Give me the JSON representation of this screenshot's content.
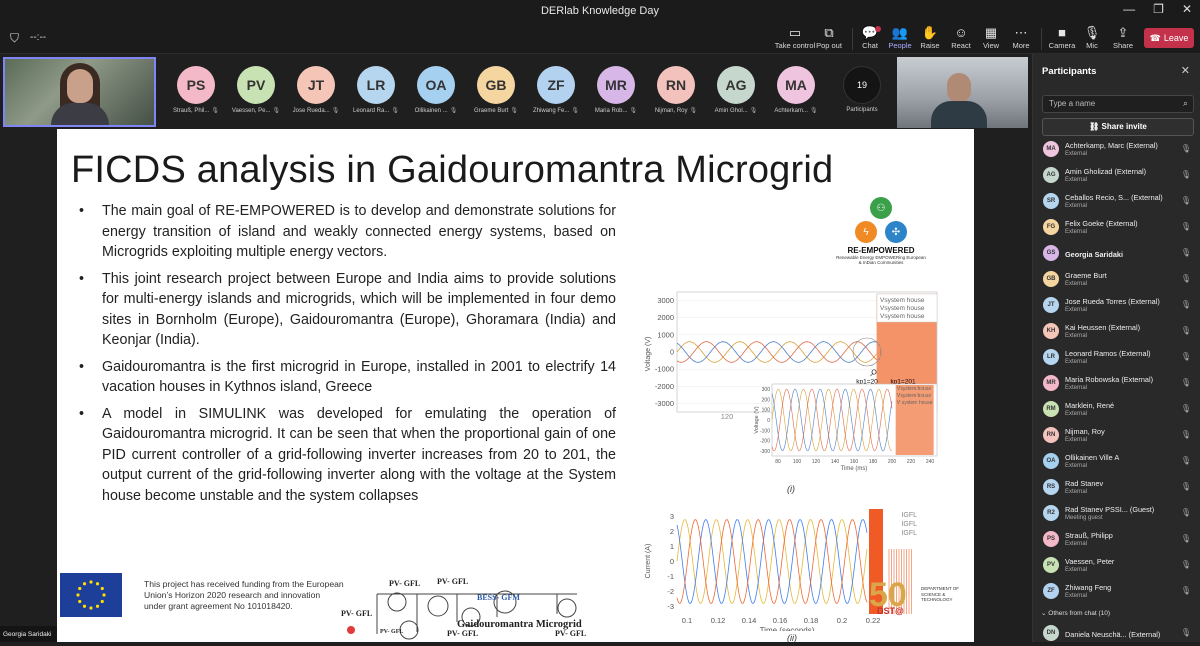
{
  "window": {
    "title": "DERlab Knowledge Day",
    "controls": [
      "—",
      "❐",
      "✕"
    ]
  },
  "meeting": {
    "timer": "--:--"
  },
  "toolbar": {
    "items": [
      {
        "label": "Take control",
        "icon": "▭"
      },
      {
        "label": "Pop out",
        "icon": "⧉"
      },
      {
        "label": "Chat",
        "icon": "💬"
      },
      {
        "label": "People",
        "icon": "👥"
      },
      {
        "label": "Raise",
        "icon": "✋"
      },
      {
        "label": "React",
        "icon": "☺"
      },
      {
        "label": "View",
        "icon": "▦"
      },
      {
        "label": "More",
        "icon": "⋯"
      },
      {
        "label": "Camera",
        "icon": "■"
      },
      {
        "label": "Mic",
        "icon": "🎙"
      },
      {
        "label": "Share",
        "icon": "⇪"
      }
    ],
    "leave_label": "Leave",
    "leave_color": "#c4314b",
    "accent": "#a9acff"
  },
  "strip": {
    "tiles": [
      {
        "initials": "PS",
        "name": "Strauß, Phil...",
        "color": "#f4b9c8"
      },
      {
        "initials": "PV",
        "name": "Vaessen, Pe...",
        "color": "#c9e2b3"
      },
      {
        "initials": "JT",
        "name": "Jose Rueda...",
        "color": "#f5c6b7"
      },
      {
        "initials": "LR",
        "name": "Leonard Ra...",
        "color": "#b6d5ef"
      },
      {
        "initials": "OA",
        "name": "Ollikainen ...",
        "color": "#a6d0ef"
      },
      {
        "initials": "GB",
        "name": "Graeme Burt",
        "color": "#f6d6a0"
      },
      {
        "initials": "ZF",
        "name": "Zhiwang Fe...",
        "color": "#b2d2f0"
      },
      {
        "initials": "MR",
        "name": "Maria Rob...",
        "color": "#d7b7e8"
      },
      {
        "initials": "RN",
        "name": "Nijman, Roy",
        "color": "#f4c2bd"
      },
      {
        "initials": "AG",
        "name": "Amin Ghol...",
        "color": "#c6d8ce"
      },
      {
        "initials": "MA",
        "name": "Achterkam...",
        "color": "#efc4de"
      }
    ],
    "participants_count": "19",
    "participants_label": "Participants"
  },
  "slide": {
    "title": "FICDS analysis in Gaidouromantra Microgrid",
    "bullets": [
      "The main goal of RE-EMPOWERED is to develop and demonstrate solutions for energy transition of island and weakly connected energy systems, based on Microgrids exploiting multiple energy vectors.",
      "This joint research project between Europe and India aims to provide solutions for multi-energy islands and microgrids, which will be implemented in four demo sites in Bornholm (Europe), Gaidouromantra (Europe), Ghoramara (India) and Keonjar (India).",
      "Gaidouromantra is the first microgrid in Europe, installed in 2001 to electrify 14 vacation houses in Kythnos island, Greece",
      "A model in SIMULINK was developed for emulating the operation of Gaidouromantra microgrid. It can be seen that when the proportional gain of one PID current controller of a grid-following inverter increases from 20 to 201, the output current of the grid-following inverter along with the voltage at the System house become unstable and the system collapses"
    ],
    "logo": {
      "name": "RE-EMPOWERED",
      "tagline": "Renewable Energy EMPOWERing European & InDian Communities"
    },
    "funding_text": "This project has received funding from the European Union’s Horizon 2020 research and innovation under grant agreement No 101018420.",
    "diagram": {
      "title": "Gaidouromantra Microgrid",
      "labels": [
        "PV- GFL",
        "PV- GFL",
        "PV- GFL",
        "PV- GFL",
        "PV- GFL",
        "PV- GFL",
        "BESS- GFM"
      ]
    },
    "dst": {
      "fifty": "50",
      "label": "DST@",
      "dept": "DEPARTMENT OF SCIENCE & TECHNOLOGY"
    },
    "figure_labels": {
      "top": "(i)",
      "bottom": "(ii)"
    }
  },
  "chart_data": [
    {
      "type": "line",
      "title": "",
      "ylabel": "Voltage (V)",
      "xlabel": "",
      "ylim": [
        -3500,
        3500
      ],
      "yticks": [
        3000,
        2000,
        1000,
        0,
        -1000,
        -2000,
        -3000
      ],
      "legend": [
        "Vsystem house",
        "Vsystem house",
        "Vsystem house"
      ],
      "annotations": [
        "kp1=20",
        "kp1=201"
      ],
      "series": [
        {
          "color": "#d9a33a"
        },
        {
          "color": "#4f7fc9"
        },
        {
          "color": "#e06a4a"
        }
      ]
    },
    {
      "type": "line",
      "ylabel": "Voltage (V)",
      "xlabel": "Time (ms)",
      "xticks": [
        80,
        100,
        120,
        140,
        160,
        180,
        200,
        220,
        240
      ],
      "yticks": [
        300,
        200,
        100,
        0,
        -100,
        -200,
        -300
      ],
      "legend": [
        "Vsystem house",
        "Vsystem house",
        "V system house"
      ],
      "x_extra_tick": "120"
    },
    {
      "type": "line",
      "title": "",
      "ylabel": "Current (A)",
      "xlabel": "Time (seconds)",
      "yticks": [
        3,
        2,
        1,
        0,
        -1,
        -2,
        -3
      ],
      "xticks": [
        "0.1",
        "0.12",
        "0.14",
        "0.16",
        "0.18",
        "0.2",
        "0.22"
      ],
      "legend": [
        "IGFL",
        "IGFL",
        "IGFL"
      ],
      "series": [
        {
          "color": "#e6b93a"
        },
        {
          "color": "#3d7ff0"
        },
        {
          "color": "#f06a35"
        }
      ]
    }
  ],
  "panel": {
    "title": "Participants",
    "search_placeholder": "Type a name",
    "share_label": "Share invite",
    "people": [
      {
        "initials": "MA",
        "name": "Achterkamp, Marc (External)",
        "sub": "External",
        "color": "#efc4de"
      },
      {
        "initials": "AG",
        "name": "Amin Gholizad (External)",
        "sub": "External",
        "color": "#c6d8ce"
      },
      {
        "initials": "SR",
        "name": "Ceballos Recio, S... (External)",
        "sub": "External",
        "color": "#b6d5ef"
      },
      {
        "initials": "FG",
        "name": "Felix Goeke (External)",
        "sub": "External",
        "color": "#f6d6a0"
      },
      {
        "initials": "GS",
        "name": "Georgia Saridaki",
        "sub": "",
        "color": "#d7b7e8"
      },
      {
        "initials": "GB",
        "name": "Graeme Burt",
        "sub": "External",
        "color": "#f6d6a0"
      },
      {
        "initials": "JT",
        "name": "Jose Rueda Torres (External)",
        "sub": "External",
        "color": "#b6d5ef"
      },
      {
        "initials": "KH",
        "name": "Kai Heussen (External)",
        "sub": "External",
        "color": "#f5c6b7"
      },
      {
        "initials": "LR",
        "name": "Leonard Ramos (External)",
        "sub": "External",
        "color": "#b6d5ef"
      },
      {
        "initials": "MR",
        "name": "Maria Robowska (External)",
        "sub": "External",
        "color": "#f4b9c8"
      },
      {
        "initials": "RM",
        "name": "Marklein, René",
        "sub": "External",
        "color": "#c9e2b3"
      },
      {
        "initials": "RN",
        "name": "Nijman, Roy",
        "sub": "External",
        "color": "#f4c2bd"
      },
      {
        "initials": "OA",
        "name": "Ollikainen Ville A",
        "sub": "External",
        "color": "#a6d0ef"
      },
      {
        "initials": "RS",
        "name": "Rad Stanev",
        "sub": "External",
        "color": "#b6d5ef"
      },
      {
        "initials": "R2",
        "name": "Rad Stanev PSSI...   (Guest)",
        "sub": "Meeting guest",
        "color": "#b6d5ef"
      },
      {
        "initials": "PS",
        "name": "Strauß, Philipp",
        "sub": "External",
        "color": "#f4b9c8"
      },
      {
        "initials": "PV",
        "name": "Vaessen, Peter",
        "sub": "External",
        "color": "#c9e2b3"
      },
      {
        "initials": "ZF",
        "name": "Zhiwang Feng",
        "sub": "External",
        "color": "#b2d2f0"
      }
    ],
    "group_label": "Others from chat (10)",
    "chat_person": {
      "initials": "DN",
      "name": "Daniela Neuschä... (External)",
      "color": "#c6d8ce"
    }
  },
  "presenter_name": "Georgia Saridaki"
}
